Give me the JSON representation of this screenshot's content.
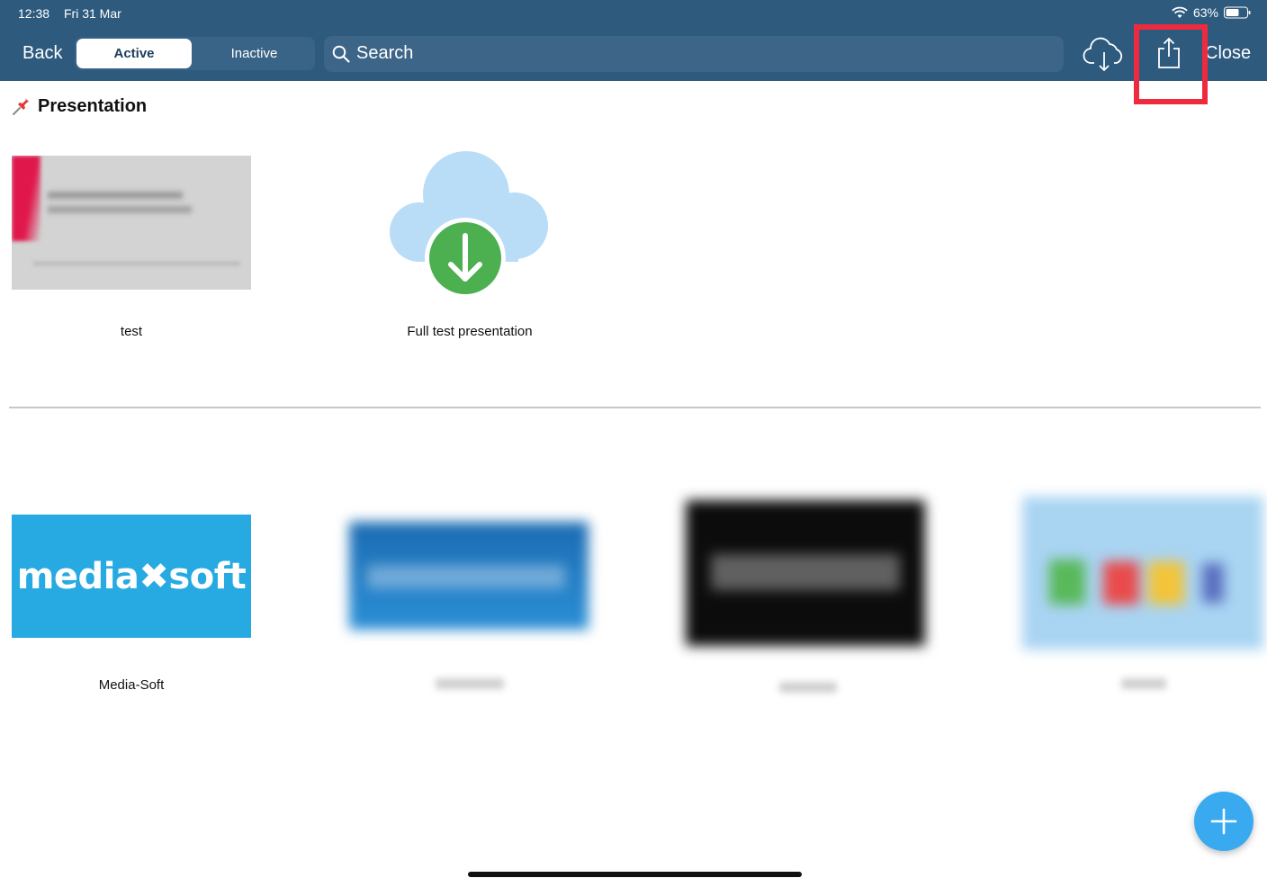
{
  "status_bar": {
    "time": "12:38",
    "date": "Fri 31 Mar",
    "battery": "63%",
    "icons": [
      "wifi-icon",
      "battery-icon"
    ]
  },
  "toolbar": {
    "back_label": "Back",
    "segments": [
      {
        "label": "Active",
        "selected": true
      },
      {
        "label": "Inactive",
        "selected": false
      }
    ],
    "search_placeholder": "Search",
    "icons": [
      "search-icon",
      "cloud-download-icon",
      "share-icon"
    ],
    "close_label": "Close"
  },
  "colors": {
    "toolbar_bg": "#2e5a7e",
    "highlight": "#ee2b3e",
    "fab": "#3aaaf0",
    "download_badge": "#4caf50",
    "cloud": "#b9ddf7"
  },
  "pinned_section": {
    "icon": "pushpin-icon",
    "title": "Presentation",
    "items": [
      {
        "label": "test"
      },
      {
        "label": "Full test presentation"
      }
    ]
  },
  "media_section": {
    "items": [
      {
        "label": "Media-Soft",
        "logo_text": "mediasoft"
      }
    ]
  },
  "fab": {
    "icon": "plus-icon"
  }
}
